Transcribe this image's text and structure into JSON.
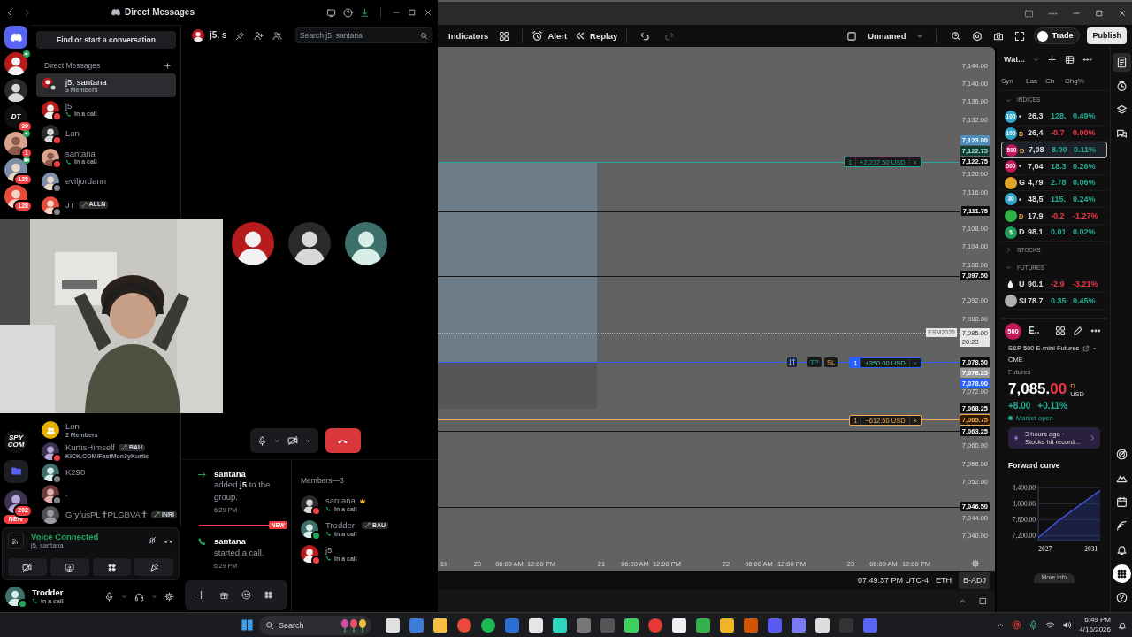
{
  "discord": {
    "title": "Direct Messages",
    "find_button": "Find or start a conversation",
    "servers_top": [
      {
        "kind": "home"
      },
      {
        "kind": "avatar",
        "speaking": true
      },
      {
        "kind": "avatar"
      },
      {
        "kind": "text",
        "label": "DT",
        "badge": "39"
      },
      {
        "kind": "avatar",
        "speaking": true,
        "badge": "1"
      },
      {
        "kind": "avatar",
        "video": true,
        "badge": "128"
      },
      {
        "kind": "avatar",
        "badge": "128"
      }
    ],
    "servers_bottom": [
      {
        "kind": "text",
        "label": "SPY COM"
      },
      {
        "kind": "folder"
      },
      {
        "kind": "avatar",
        "badge": "202"
      },
      {
        "kind": "pill",
        "label": "NEW"
      }
    ],
    "dm_heading": "Direct Messages",
    "dms_top": [
      {
        "kind": "group",
        "name": "j5, santana",
        "sub": "3 Members",
        "selected": true
      },
      {
        "kind": "user",
        "name": "j5",
        "sub": "In a call",
        "call": true,
        "color": "#f23f43",
        "selected": false
      },
      {
        "kind": "user",
        "name": "Lon",
        "color": "#f23f43",
        "selected": false
      },
      {
        "kind": "user",
        "name": "santana",
        "sub": "In a call",
        "call": true,
        "color": "#f23f43",
        "selected": false
      },
      {
        "kind": "user",
        "name": "eviljordann",
        "color": "#80848e",
        "selected": false
      },
      {
        "kind": "user",
        "name": "JT",
        "tag": "ALLN",
        "color": "#80848e",
        "selected": false
      }
    ],
    "dms_bottom": [
      {
        "kind": "group_icon",
        "name": "Lon",
        "sub": "2 Members",
        "selected": false
      },
      {
        "kind": "user",
        "name": "KurtisHimself",
        "tag": "BAU",
        "sub": "KICK.COM/FastMon3yKurtis",
        "color": "#f23f43",
        "selected": false
      },
      {
        "kind": "user",
        "name": "K290",
        "color": "#80848e",
        "selected": false
      },
      {
        "kind": "user",
        "name": ".",
        "color": "#80848e",
        "selected": false
      },
      {
        "kind": "user",
        "name": "GryfusPL✝PLGBVA✝",
        "tag": "INRI",
        "selected": false
      }
    ],
    "voice": {
      "title": "Voice Connected",
      "channel": "j5, santana"
    },
    "user": {
      "name": "Trodder",
      "sub": "In a call",
      "color": "#23a55a"
    },
    "channel": {
      "name": "j5, s",
      "search_placeholder": "Search j5, santana"
    },
    "call_tiles": [
      {
        "kind": "avatar"
      },
      {
        "kind": "avatar"
      },
      {
        "kind": "avatar"
      }
    ],
    "messages": [
      {
        "kind": "join",
        "author": "santana",
        "text": "added **j5** to the group.",
        "time": "6:29 PM",
        "new_before": false
      },
      {
        "kind": "call",
        "author": "santana",
        "text": "started a call.",
        "time": "6:29 PM",
        "new_before": true
      }
    ],
    "new_label": "NEW",
    "members_title": "Members—3",
    "members": [
      {
        "name": "santana",
        "owner": true,
        "sub": "In a call",
        "color": "#f23f43"
      },
      {
        "name": "Trodder",
        "owner": false,
        "tag": "BAU",
        "sub": "In a call",
        "color": "#23a55a"
      },
      {
        "name": "j5",
        "owner": false,
        "sub": "In a call",
        "color": "#f23f43"
      }
    ]
  },
  "tradingview": {
    "toolbar_left": [
      {
        "kind": "text",
        "label": "Indicators"
      },
      {
        "kind": "icon"
      },
      {
        "kind": "text",
        "label": "Alert"
      },
      {
        "kind": "text",
        "label": "Replay"
      },
      {
        "kind": "icon",
        "disabled": false
      },
      {
        "kind": "icon",
        "disabled": true
      }
    ],
    "layout_name": "Unnamed",
    "trade_button": "Trade",
    "publish_button": "Publish",
    "price_axis": [
      {
        "text": "7,144.00",
        "kind": "tick"
      },
      {
        "text": "7,140.00",
        "kind": "tick"
      },
      {
        "text": "7,136.00",
        "kind": "tick"
      },
      {
        "text": "7,132.00",
        "kind": "tick"
      },
      {
        "text": "7,123.00",
        "kind": "light_blue"
      },
      {
        "text": "7,122.75",
        "kind": "green"
      },
      {
        "text": "7,122.75",
        "kind": "black",
        "line": {
          "color": "#26a69a",
          "dotted": false
        },
        "order": {
          "qty": "1",
          "pnl": "+2,237.50 USD",
          "close": "×",
          "color": "#26a69a",
          "active": false
        }
      },
      {
        "text": "7,120.00",
        "kind": "tick"
      },
      {
        "text": "7,116.00",
        "kind": "tick"
      },
      {
        "text": "7,111.75",
        "kind": "black",
        "line": {
          "color": "#151515",
          "dotted": false
        }
      },
      {
        "text": "7,108.00",
        "kind": "tick"
      },
      {
        "text": "7,104.00",
        "kind": "tick"
      },
      {
        "text": "7,100.00",
        "kind": "tick"
      },
      {
        "text": "7,097.50",
        "kind": "black",
        "line": {
          "color": "#151515",
          "dotted": false
        }
      },
      {
        "text": "7,092.00",
        "kind": "tick"
      },
      {
        "text": "7,088.00",
        "kind": "tick"
      },
      {
        "text": "7,085.00",
        "kind": "white",
        "sub": "20:23",
        "tag": "ESM2026",
        "line": {
          "color": "#b4b4b4",
          "dotted": true
        }
      },
      {
        "text": "7,078.50",
        "kind": "black",
        "line": {
          "color": "#2962ff",
          "dotted": false
        },
        "order": {
          "qty": "1",
          "pnl": "+350.00 USD",
          "close": "×",
          "color": "#2962ff",
          "active": true,
          "brackets": [
            "TP",
            "SL"
          ]
        }
      },
      {
        "text": "7,078.25",
        "kind": "grey"
      },
      {
        "text": "7,078.00",
        "kind": "blue"
      },
      {
        "text": "7,072.00",
        "kind": "tick"
      },
      {
        "text": "7,068.25",
        "kind": "black"
      },
      {
        "text": "7,065.75",
        "kind": "orange",
        "line": {
          "color": "#f7a84a",
          "dotted": false
        },
        "order": {
          "qty": "1",
          "pnl": "−612.50 USD",
          "close": "×",
          "color": "#f7a84a",
          "active": false
        }
      },
      {
        "text": "7,063.25",
        "kind": "black",
        "line": {
          "color": "#151515",
          "dotted": false
        }
      },
      {
        "text": "7,060.00",
        "kind": "tick"
      },
      {
        "text": "7,056.00",
        "kind": "tick"
      },
      {
        "text": "7,052.00",
        "kind": "tick"
      },
      {
        "text": "7,046.50",
        "kind": "black",
        "line": {
          "color": "#151515",
          "dotted": false
        }
      },
      {
        "text": "7,044.00",
        "kind": "tick"
      },
      {
        "text": "7,040.00",
        "kind": "tick"
      }
    ],
    "time_axis": [
      "19",
      "20",
      "06:00 AM",
      "12:00 PM",
      "21",
      "06:00 AM",
      "12:00 PM",
      "22",
      "06:00 AM",
      "12:00 PM",
      "23",
      "06:00 AM",
      "12:00 PM"
    ],
    "status_bar": [
      {
        "kind": "text",
        "label": "07:49:37 PM UTC-4"
      },
      {
        "kind": "text",
        "label": "ETH"
      },
      {
        "kind": "button",
        "label": "B-ADJ"
      }
    ]
  },
  "watchlist": {
    "title": "Wat...",
    "columns": [
      "Syn",
      "Las",
      "Ch",
      "Chg%"
    ],
    "sections": [
      {
        "name": "INDICES",
        "expanded": true,
        "rows": [
          {
            "kind": "badge",
            "logo": "100",
            "color": "#2fa7c9",
            "marker": {
              "kind": "dot"
            },
            "last": "26,3",
            "change": "128.",
            "change_pct": "0.49%",
            "down": false,
            "selected": false
          },
          {
            "kind": "badge",
            "logo": "100",
            "color": "#2fa7c9",
            "marker": {
              "kind": "delayed",
              "text": "D"
            },
            "last": "26,4",
            "change": "-0.7",
            "change_pct": "0.00%",
            "down": true,
            "selected": false
          },
          {
            "kind": "badge",
            "logo": "500",
            "color": "#c2185b",
            "marker": {
              "kind": "delayed",
              "text": "D"
            },
            "last": "7,08",
            "change": "8.00",
            "change_pct": "0.11%",
            "down": false,
            "selected": true
          },
          {
            "kind": "badge",
            "logo": "500",
            "color": "#c2185b",
            "marker": {
              "kind": "dot"
            },
            "last": "7,04",
            "change": "18.3",
            "change_pct": "0.26%",
            "down": false,
            "selected": false
          },
          {
            "kind": "badge",
            "color": "#e0a526",
            "symbol": "G",
            "last": "4,79",
            "change": "2.78",
            "change_pct": "0.06%",
            "down": false,
            "selected": false
          },
          {
            "kind": "badge",
            "logo": "30",
            "color": "#2fa7c9",
            "marker": {
              "kind": "dot"
            },
            "last": "48,5",
            "change": "115.",
            "change_pct": "0.24%",
            "down": false,
            "selected": false
          },
          {
            "kind": "badge",
            "color": "#2fb344",
            "marker": {
              "kind": "delayed",
              "text": "D"
            },
            "last": "17.9",
            "change": "-0.2",
            "change_pct": "-1.27%",
            "down": true,
            "selected": false
          },
          {
            "kind": "badge",
            "logo": "$",
            "color": "#1f9e5a",
            "symbol": "D",
            "last": "98.1",
            "change": "0.01",
            "change_pct": "0.02%",
            "down": false,
            "selected": false
          }
        ]
      },
      {
        "name": "STOCKS",
        "expanded": false
      },
      {
        "name": "FUTURES",
        "expanded": true,
        "rows": [
          {
            "kind": "drop",
            "color": "#f0f0f0",
            "symbol": "U",
            "last": "90.1",
            "change": "-2.9",
            "change_pct": "-3.21%",
            "down": true,
            "selected": false
          },
          {
            "kind": "badge",
            "color": "#b0b0b0",
            "symbol": "SI",
            "last": "78.7",
            "change": "0.35",
            "change_pct": "0.45%",
            "down": false,
            "selected": false
          }
        ]
      }
    ]
  },
  "symbol": {
    "logo": "500",
    "short": "E..",
    "name": "S&P 500 E-mini Futures",
    "separator": "•",
    "exchange": "CME",
    "type": "Futures",
    "price_main": "7,085.",
    "price_tail": "00",
    "delay": "D",
    "currency": "USD",
    "change": "+8.00",
    "change_pct": "+0.11%",
    "market": "Market open",
    "news": {
      "time": "3 hours ago ·",
      "headline": "Stocks hit record..."
    },
    "forward_curve": {
      "title": "Forward curve",
      "chart_data": {
        "type": "area",
        "x": [
          2026.4,
          2028,
          2030,
          2031.8
        ],
        "series": [
          {
            "color": "#3f51d8",
            "values": [
              7150,
              7540,
              7960,
              8330
            ]
          }
        ],
        "xlim": [
          2026.4,
          2031.8
        ],
        "ylim": [
          7080,
          8450
        ],
        "xticks": [
          2027,
          2031
        ],
        "yticks": [
          {
            "value": 7200,
            "label": "7,200.00"
          },
          {
            "value": 7600,
            "label": "7,600.00"
          },
          {
            "value": 8000,
            "label": "8,000.00"
          },
          {
            "value": 8400,
            "label": "8,400.00"
          }
        ],
        "grid": true
      }
    },
    "more_info": "More info"
  },
  "taskbar": {
    "search": {
      "placeholder": "Search"
    },
    "time": "6:49 PM",
    "date": "4/16/2026"
  }
}
